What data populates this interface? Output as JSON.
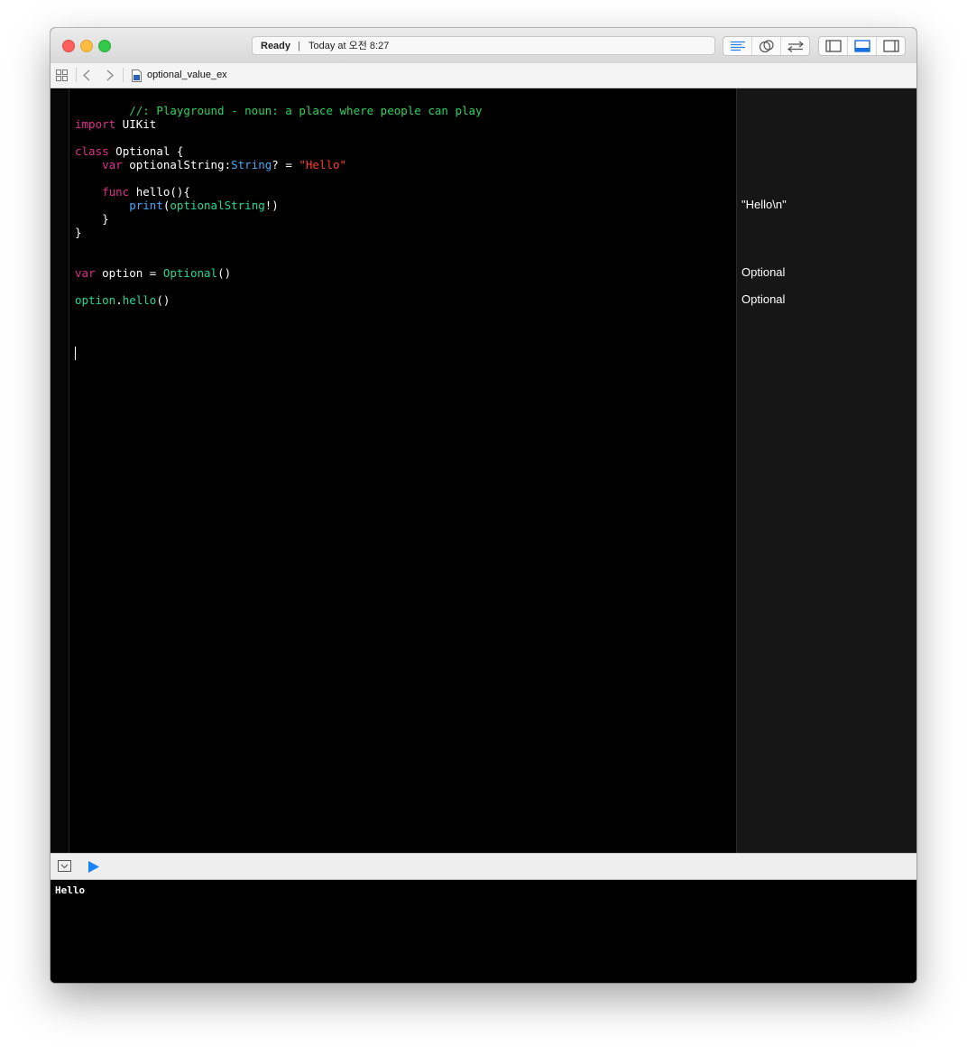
{
  "window": {
    "activity_status": "Ready",
    "activity_separator": "|",
    "activity_time": "Today at 오전 8:27"
  },
  "jumpbar": {
    "file_name": "optional_value_ex"
  },
  "toolbar": {
    "editor_icons": [
      "standard-editor-icon",
      "assistant-editor-icon",
      "version-editor-icon"
    ],
    "view_icons": [
      "navigator-toggle-icon",
      "debug-area-toggle-icon",
      "utilities-toggle-icon"
    ]
  },
  "code": {
    "comment_line": "//: Playground - noun: a place where people can play",
    "import_kw": "import",
    "import_mod": " UIKit",
    "class_kw": "class",
    "class_name": " Optional {",
    "var_kw": "var",
    "var_name": " optionalString:",
    "var_type": "String",
    "var_eq": "? = ",
    "var_value": "\"Hello\"",
    "func_kw": "func",
    "func_name": " hello(){",
    "print_fn": "print",
    "print_open": "(",
    "print_arg": "optionalString",
    "print_close": "!)",
    "inner_close": "}",
    "outer_close": "}",
    "var2_kw": "var",
    "var2_name": " option = ",
    "var2_type": "Optional",
    "var2_call": "()",
    "call_obj": "option",
    "call_dot": ".",
    "call_method": "hello",
    "call_parens": "()"
  },
  "results": {
    "print_result": "\"Hello\\n\"",
    "option_result": "Optional",
    "call_result": "Optional"
  },
  "console": {
    "output": "Hello"
  },
  "colors": {
    "keyword": "#e12f8e",
    "comment": "#2fd15f",
    "type": "#4aa9f0",
    "string": "#ff3b30",
    "project_symbol": "#27d994",
    "run_button": "#1a82f7"
  }
}
